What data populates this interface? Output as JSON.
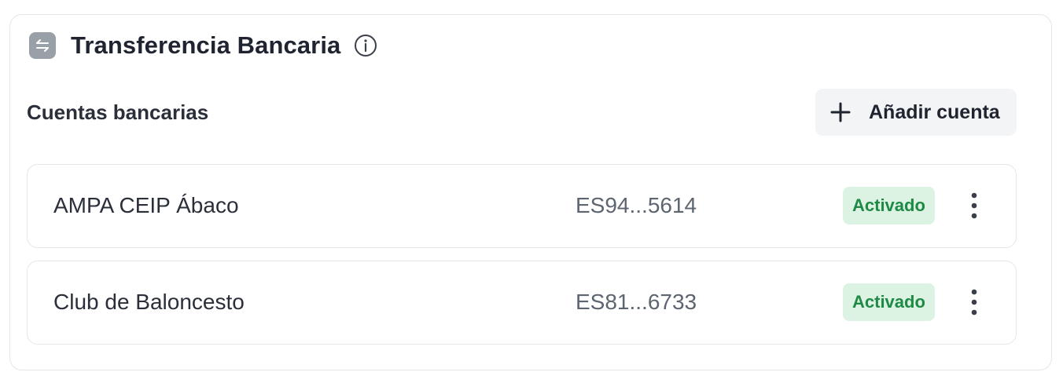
{
  "section": {
    "title": "Transferencia Bancaria",
    "method_icon": "bank-transfer-arrows-icon",
    "info_icon": "info-icon"
  },
  "accounts": {
    "heading": "Cuentas bancarias",
    "add_button_label": "Añadir cuenta",
    "add_icon": "plus-icon",
    "items": [
      {
        "name": "AMPA CEIP Ábaco",
        "iban": "ES94...5614",
        "status": "Activado",
        "menu_icon": "more-vertical-icon"
      },
      {
        "name": "Club de Baloncesto",
        "iban": "ES81...6733",
        "status": "Activado",
        "menu_icon": "more-vertical-icon"
      }
    ]
  },
  "colors": {
    "status_bg": "#dcf3e3",
    "status_text": "#1e8a45",
    "method_icon_bg": "#9aa0a8",
    "button_bg": "#f3f4f6"
  }
}
